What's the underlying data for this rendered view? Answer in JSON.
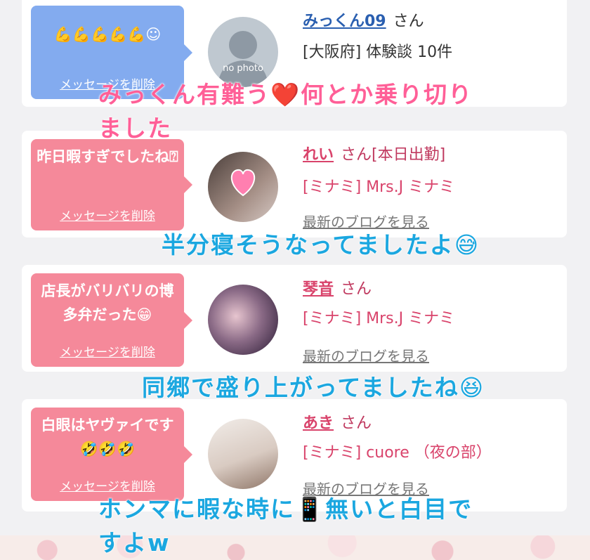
{
  "entries": [
    {
      "message": "💪💪💪💪💪☺",
      "delete_label": "メッセージを削除",
      "name": "みっくん09",
      "honorific": "さん",
      "info": "[大阪府] 体験談 10件",
      "avatar_text": "no photo"
    },
    {
      "message": "昨日暇すぎでしたね⍰",
      "delete_label": "メッセージを削除",
      "name": "れい",
      "honorific": "さん[本日出勤]",
      "info": "[ミナミ] Mrs.J ミナミ",
      "blog": "最新のブログを見る"
    },
    {
      "message": "店長がバリバリの博多弁だった😁",
      "delete_label": "メッセージを削除",
      "name": "琴音",
      "honorific": "さん",
      "info": "[ミナミ] Mrs.J ミナミ",
      "blog": "最新のブログを見る"
    },
    {
      "message": "白眼はヤヴァイです🤣🤣🤣",
      "delete_label": "メッセージを削除",
      "name": "あき",
      "honorific": "さん",
      "info": "[ミナミ] cuore （夜の部）",
      "blog": "最新のブログを見る"
    }
  ],
  "overlays": {
    "line1": "みっくん有難う❤️何とか乗り切り",
    "line2": "ました",
    "line3": "半分寝そうなってましたよ😅",
    "line4": "同郷で盛り上がってましたね😆",
    "line5": "ホンマに暇な時に📱無いと白目で",
    "line6": "すよw"
  },
  "colors": {
    "blue_bubble": "#83abef",
    "pink_bubble": "#f5899a",
    "overlay_pink": "#ff5f97",
    "overlay_cyan": "#1ba7e0"
  }
}
